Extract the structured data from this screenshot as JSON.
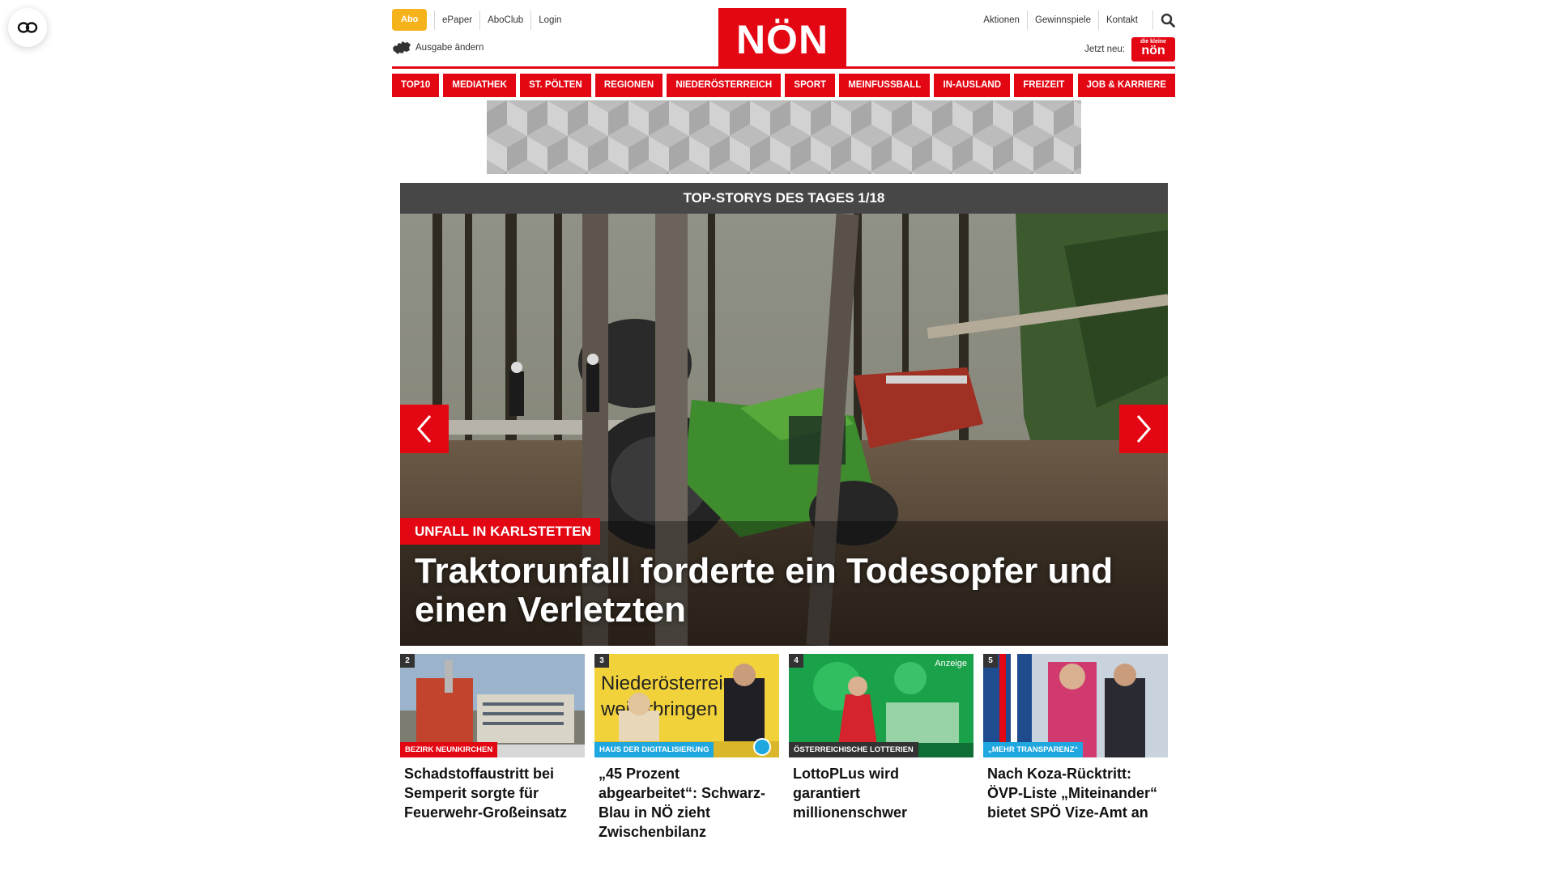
{
  "header": {
    "abo_label": "Abo",
    "left_links": [
      "ePaper",
      "AboClub",
      "Login"
    ],
    "right_links": [
      "Aktionen",
      "Gewinnspiele",
      "Kontakt"
    ],
    "logo_text": "NÖN",
    "edition_label": "Ausgabe ändern",
    "jetzt_label": "Jetzt neu:",
    "jetzt_badge_small": "die kleine",
    "jetzt_badge_text": "nön"
  },
  "nav": {
    "items": [
      "TOP10",
      "MEDIATHEK",
      "ST. PÖLTEN",
      "REGIONEN",
      "NIEDERÖSTERREICH",
      "SPORT",
      "MEINFUSSBALL",
      "IN-AUSLAND",
      "FREIZEIT",
      "JOB & KARRIERE"
    ]
  },
  "slider": {
    "title": "TOP-STORYS DES TAGES 1/18",
    "kicker": "UNFALL IN KARLSTETTEN",
    "headline": "Traktorunfall forderte ein Todesopfer und einen Verletzten"
  },
  "teasers": [
    {
      "num": "2",
      "tag": "BEZIRK NEUNKIRCHEN",
      "tag_color": "#e30613",
      "title": "Schadstoffaustritt bei Semperit sorgte für Feuerwehr-Großeinsatz"
    },
    {
      "num": "3",
      "tag": "HAUS DER DIGITALISIERUNG",
      "tag_color": "#1fa8e0",
      "title": "„45 Prozent abgearbeitet“: Schwarz-Blau in NÖ zieht Zwischenbilanz",
      "thumb_text": "Niederösterreich weiterbringen"
    },
    {
      "num": "4",
      "tag": "ÖSTERREICHISCHE LOTTERIEN",
      "tag_color": "#333333",
      "title": "LottoPLus wird garantiert millionenschwer",
      "badge": "Anzeige"
    },
    {
      "num": "5",
      "tag": "„MEHR TRANSPARENZ“",
      "tag_color": "#1fa8e0",
      "title": "Nach Koza-Rücktritt: ÖVP-Liste „Miteinander“ bietet SPÖ Vize-Amt an"
    }
  ],
  "colors": {
    "brand_red": "#e30613",
    "abo_yellow": "#f5b21b",
    "slider_head": "#474747",
    "tag_blue": "#1fa8e0"
  },
  "icons": [
    "accessibility-icon",
    "search-icon",
    "map-austria-icon",
    "chevron-left-icon",
    "chevron-right-icon",
    "play-icon"
  ]
}
